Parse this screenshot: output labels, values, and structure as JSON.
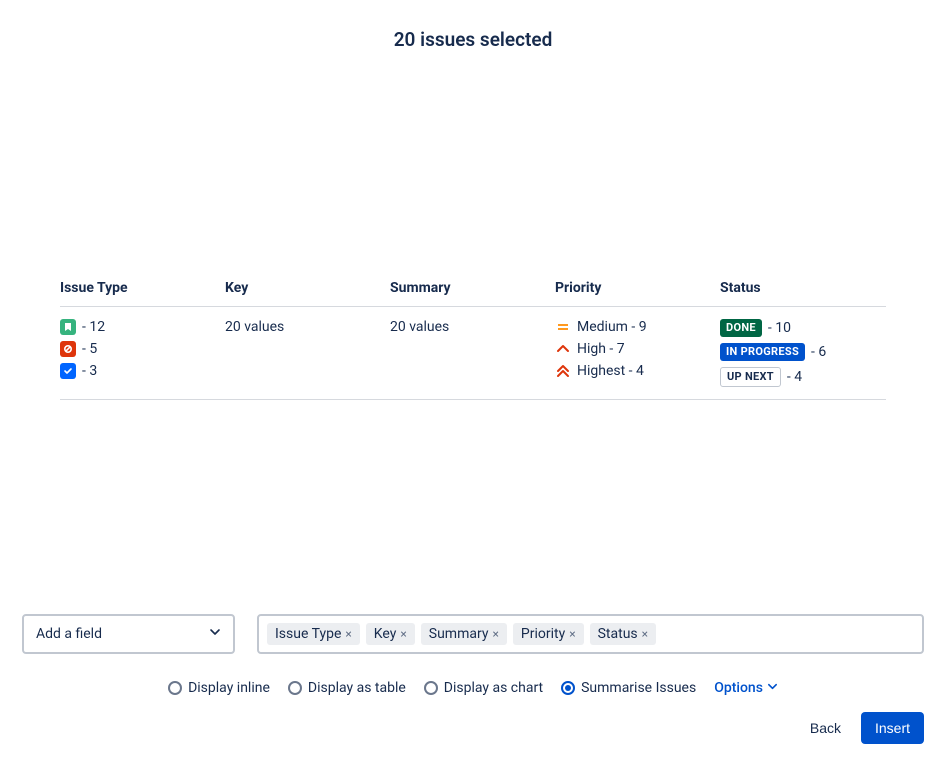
{
  "header": {
    "title": "20 issues selected"
  },
  "table": {
    "columns": {
      "issue_type": "Issue Type",
      "key": "Key",
      "summary": "Summary",
      "priority": "Priority",
      "status": "Status"
    },
    "issue_type": [
      {
        "icon": "story-icon",
        "count_text": " - 12"
      },
      {
        "icon": "bug-icon",
        "count_text": " - 5"
      },
      {
        "icon": "task-icon",
        "count_text": " - 3"
      }
    ],
    "key_text": "20 values",
    "summary_text": "20 values",
    "priority": [
      {
        "icon": "priority-medium-icon",
        "label": "Medium - 9"
      },
      {
        "icon": "priority-high-icon",
        "label": "High - 7"
      },
      {
        "icon": "priority-highest-icon",
        "label": "Highest - 4"
      }
    ],
    "status": [
      {
        "badge": "DONE",
        "badge_class": "done",
        "count_text": " - 10"
      },
      {
        "badge": "IN PROGRESS",
        "badge_class": "inprog",
        "count_text": " - 6"
      },
      {
        "badge": "UP NEXT",
        "badge_class": "upnext",
        "count_text": " - 4"
      }
    ]
  },
  "field_picker": {
    "add_label": "Add a field",
    "chips": [
      "Issue Type",
      "Key",
      "Summary",
      "Priority",
      "Status"
    ]
  },
  "display": {
    "options": [
      {
        "label": "Display inline",
        "checked": false
      },
      {
        "label": "Display as table",
        "checked": false
      },
      {
        "label": "Display as chart",
        "checked": false
      },
      {
        "label": "Summarise Issues",
        "checked": true
      }
    ],
    "options_link": "Options"
  },
  "footer": {
    "back": "Back",
    "insert": "Insert"
  }
}
